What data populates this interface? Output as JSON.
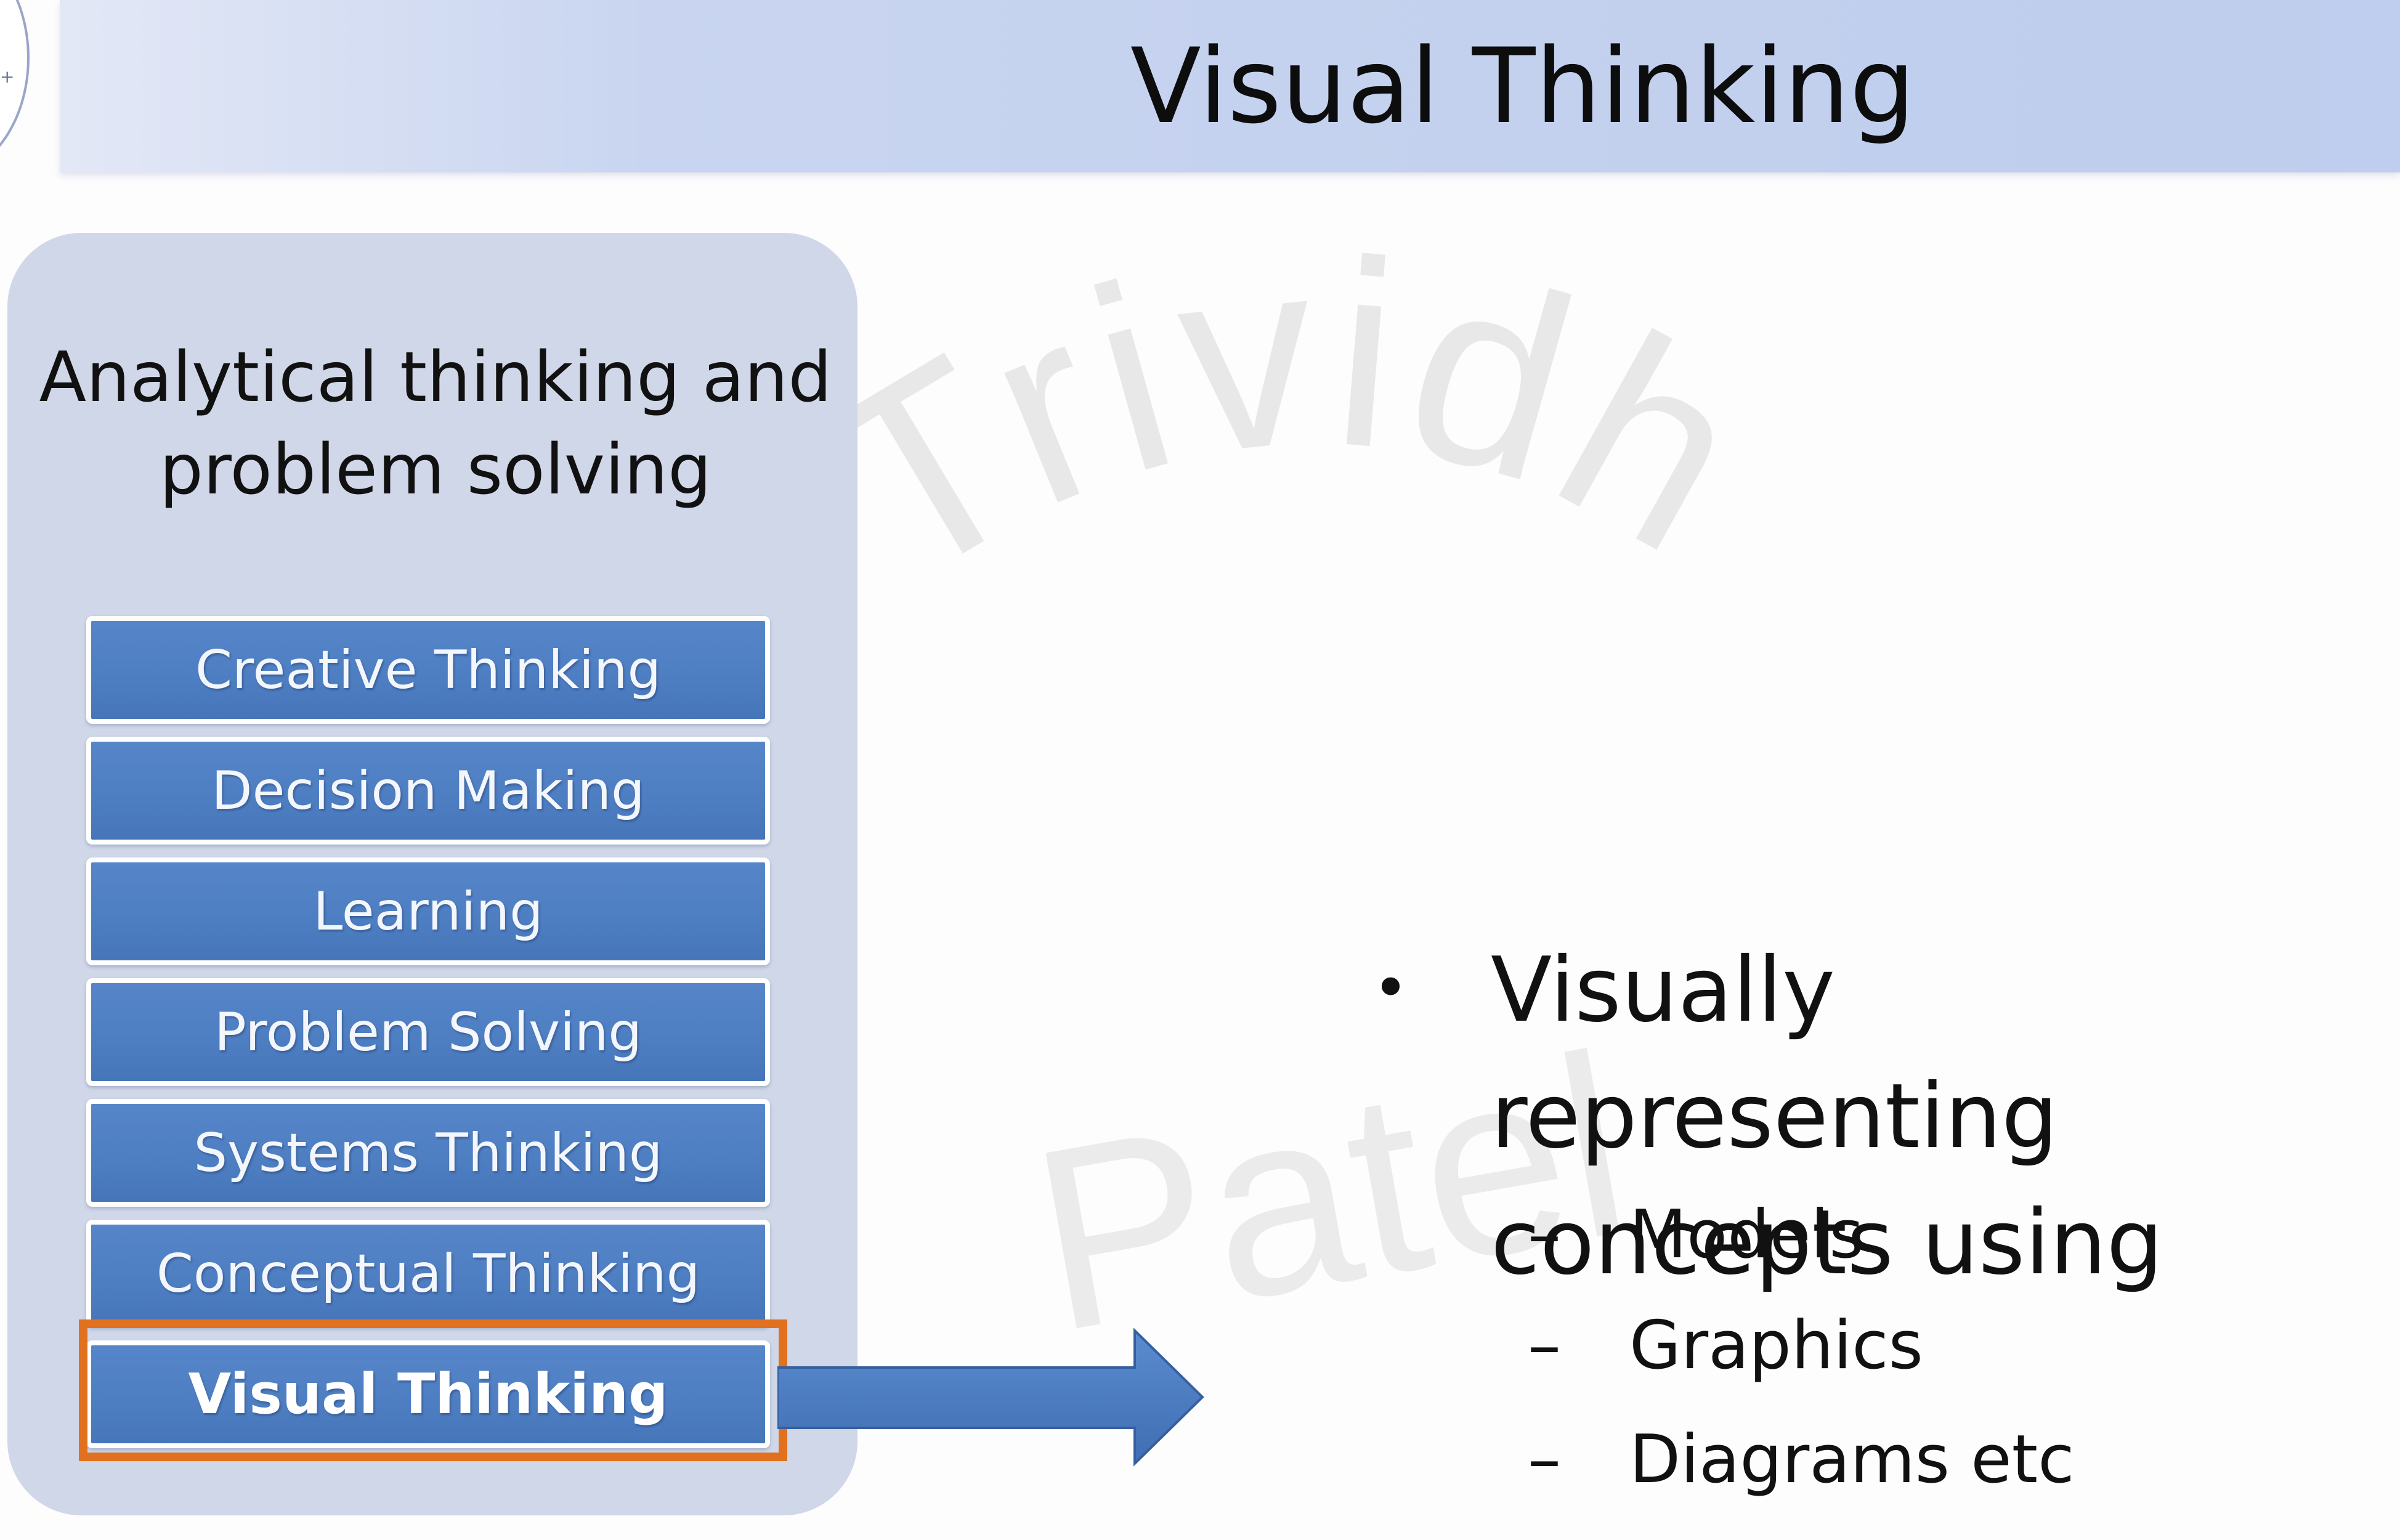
{
  "slide": {
    "title": "Visual Thinking"
  },
  "watermark": {
    "word1": "Trividh",
    "word2": "Patel"
  },
  "left_panel": {
    "heading_line1": "Analytical thinking and",
    "heading_line2": "problem solving",
    "items": [
      {
        "label": "Creative Thinking"
      },
      {
        "label": "Decision Making"
      },
      {
        "label": "Learning"
      },
      {
        "label": "Problem Solving"
      },
      {
        "label": "Systems Thinking"
      },
      {
        "label": "Conceptual Thinking"
      },
      {
        "label": "Visual Thinking"
      }
    ],
    "selected_item": "Visual Thinking",
    "highlight_color": "#e2711f",
    "item_color": "#4f7fc4"
  },
  "content": {
    "bullet_symbol": "•",
    "bullet_line1": "Visually representing",
    "bullet_line2": "concepts using",
    "sub_dash": "–",
    "sub_items": [
      "Models",
      "Graphics",
      "Diagrams etc"
    ]
  }
}
